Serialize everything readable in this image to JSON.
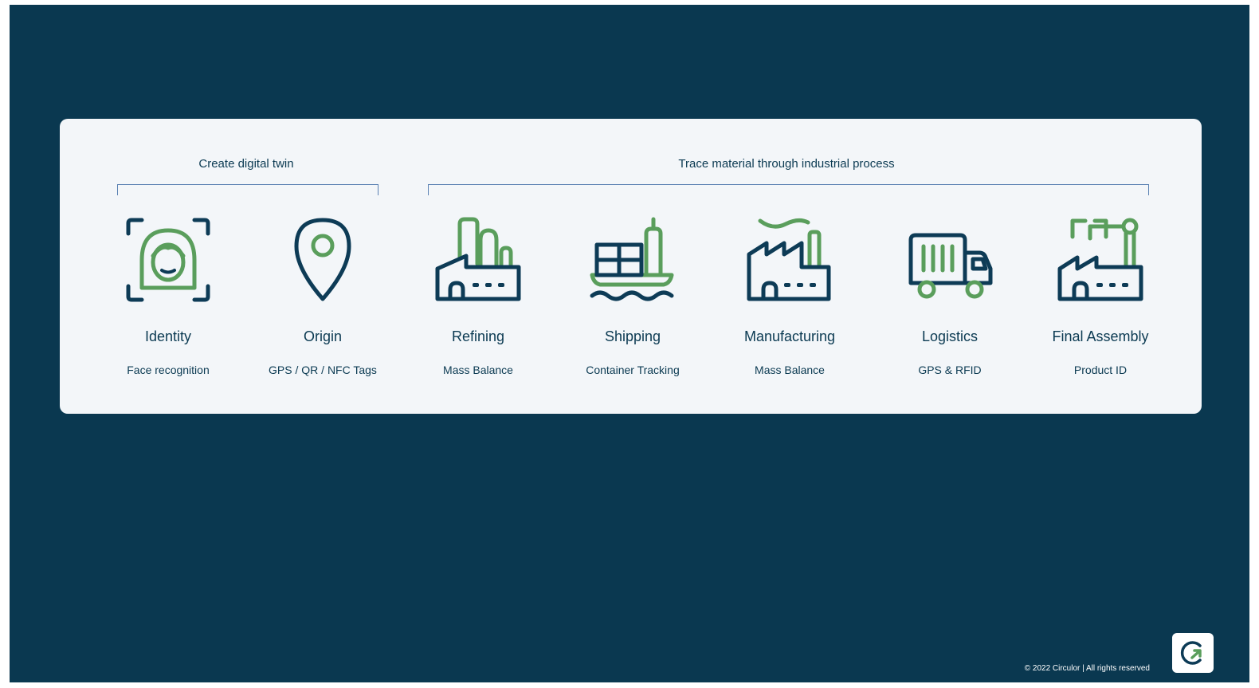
{
  "groups": [
    {
      "label": "Create digital twin"
    },
    {
      "label": "Trace material through industrial process"
    }
  ],
  "steps": [
    {
      "title": "Identity",
      "subtitle": "Face recognition",
      "icon": "face-scan-icon"
    },
    {
      "title": "Origin",
      "subtitle": "GPS / QR / NFC Tags",
      "icon": "location-pin-icon"
    },
    {
      "title": "Refining",
      "subtitle": "Mass Balance",
      "icon": "refinery-icon"
    },
    {
      "title": "Shipping",
      "subtitle": "Container Tracking",
      "icon": "container-ship-icon"
    },
    {
      "title": "Manufacturing",
      "subtitle": "Mass Balance",
      "icon": "factory-icon"
    },
    {
      "title": "Logistics",
      "subtitle": "GPS & RFID",
      "icon": "truck-icon"
    },
    {
      "title": "Final Assembly",
      "subtitle": "Product ID",
      "icon": "robot-arm-factory-icon"
    }
  ],
  "footer": {
    "copyright": "© 2022 Circulor | All rights reserved"
  },
  "logo": {
    "icon": "circulor-logo-icon"
  },
  "colors": {
    "background": "#0a3850",
    "card": "#f3f6f9",
    "navy": "#0d3b56",
    "green": "#5a9e5c",
    "bracket": "#5b82b3"
  }
}
